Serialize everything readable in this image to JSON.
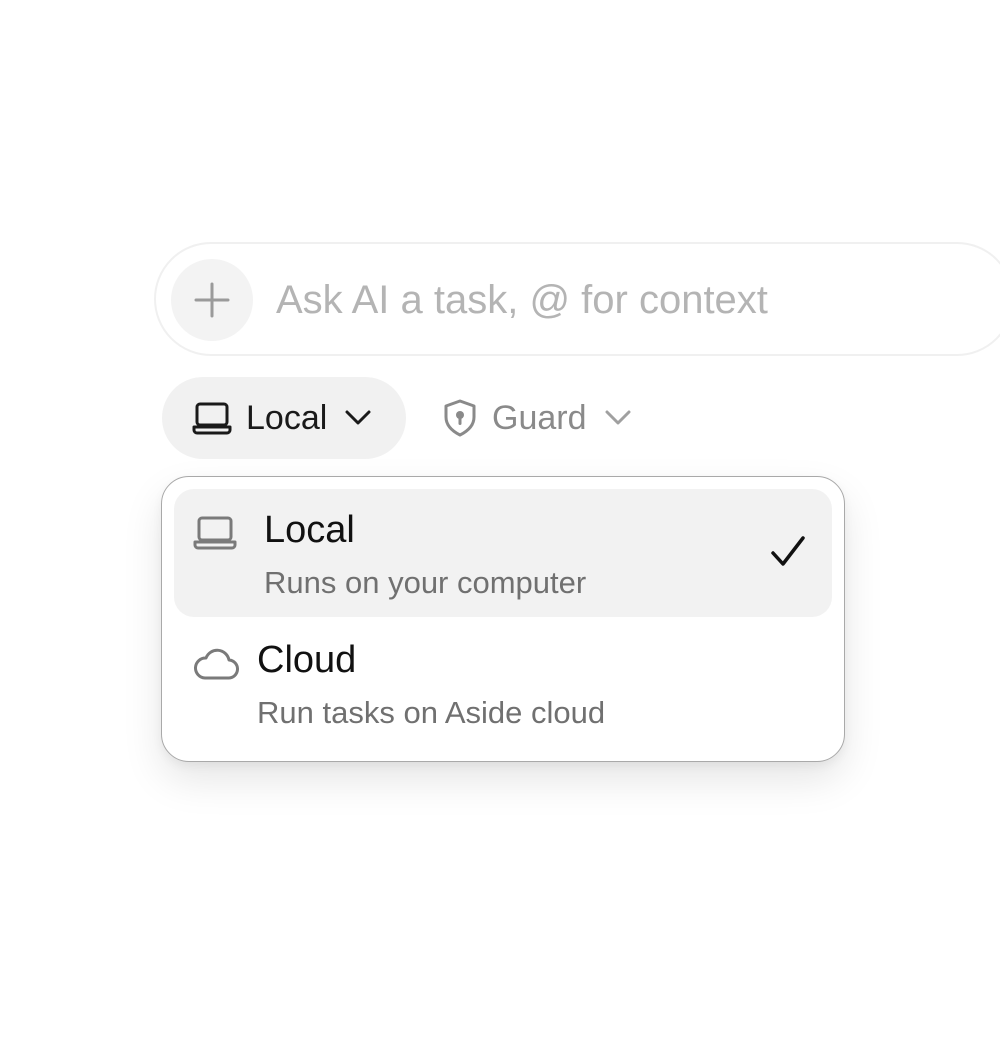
{
  "prompt": {
    "placeholder": "Ask AI a task, @ for context",
    "value": "",
    "add_icon": "plus-icon"
  },
  "mode_selector": {
    "label": "Local",
    "icon": "laptop-icon",
    "chevron_icon": "chevron-down-icon"
  },
  "guard_selector": {
    "label": "Guard",
    "icon": "shield-lock-icon",
    "chevron_icon": "chevron-down-icon"
  },
  "dropdown": {
    "options": [
      {
        "title": "Local",
        "description": "Runs on your computer",
        "icon": "laptop-icon",
        "selected": true
      },
      {
        "title": "Cloud",
        "description": "Run tasks on Aside cloud",
        "icon": "cloud-icon",
        "selected": false
      }
    ],
    "selected_icon": "check-icon"
  },
  "colors": {
    "placeholder": "#b4b4b4",
    "chip_background": "#f1f1f1",
    "selected_option_background": "#f2f2f2",
    "muted_text": "#707070",
    "inactive_chip_text": "#8a8a8a"
  }
}
